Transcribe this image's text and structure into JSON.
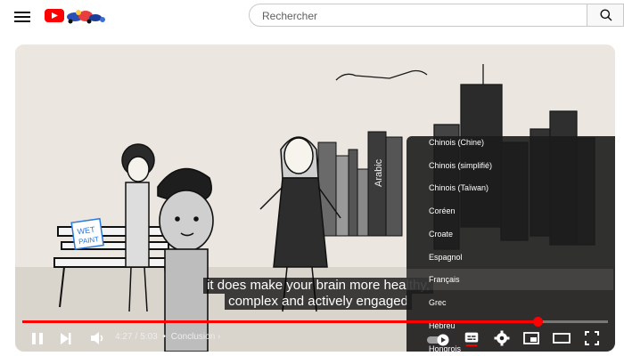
{
  "header": {
    "search_placeholder": "Rechercher"
  },
  "player": {
    "subtitle_lines": [
      "it does make your brain more healthy,",
      "complex and actively engaged"
    ],
    "time_current": "4:27",
    "time_separator": "/",
    "time_total": "5:03",
    "chapter_bullet": "•",
    "chapter": "Conclusion",
    "chapter_chevron": "›",
    "progress": 0.88,
    "autoplay": "on"
  },
  "scene_text": {
    "sign": [
      "WET",
      "PAINT"
    ],
    "book": "Arabic"
  },
  "subtitle_menu": {
    "languages": [
      "Chinois (Chine)",
      "Chinois (simplifié)",
      "Chinois (Taïwan)",
      "Coréen",
      "Croate",
      "Espagnol",
      "Français",
      "Grec",
      "Hébreu",
      "Hongrois"
    ],
    "highlighted": "Français"
  },
  "colors": {
    "accent": "#ff0000",
    "menu_bg": "#1c1c1c",
    "subtitle_bg": "#000000"
  },
  "icons": {
    "menu": "hamburger-icon",
    "search": "search-icon",
    "pause": "pause-icon",
    "next": "skip-next-icon",
    "volume": "volume-icon",
    "autoplay": "autoplay-toggle-icon",
    "captions": "subtitles-icon",
    "settings": "gear-icon",
    "miniplayer": "miniplayer-icon",
    "theater": "theater-mode-icon",
    "fullscreen": "fullscreen-icon"
  }
}
